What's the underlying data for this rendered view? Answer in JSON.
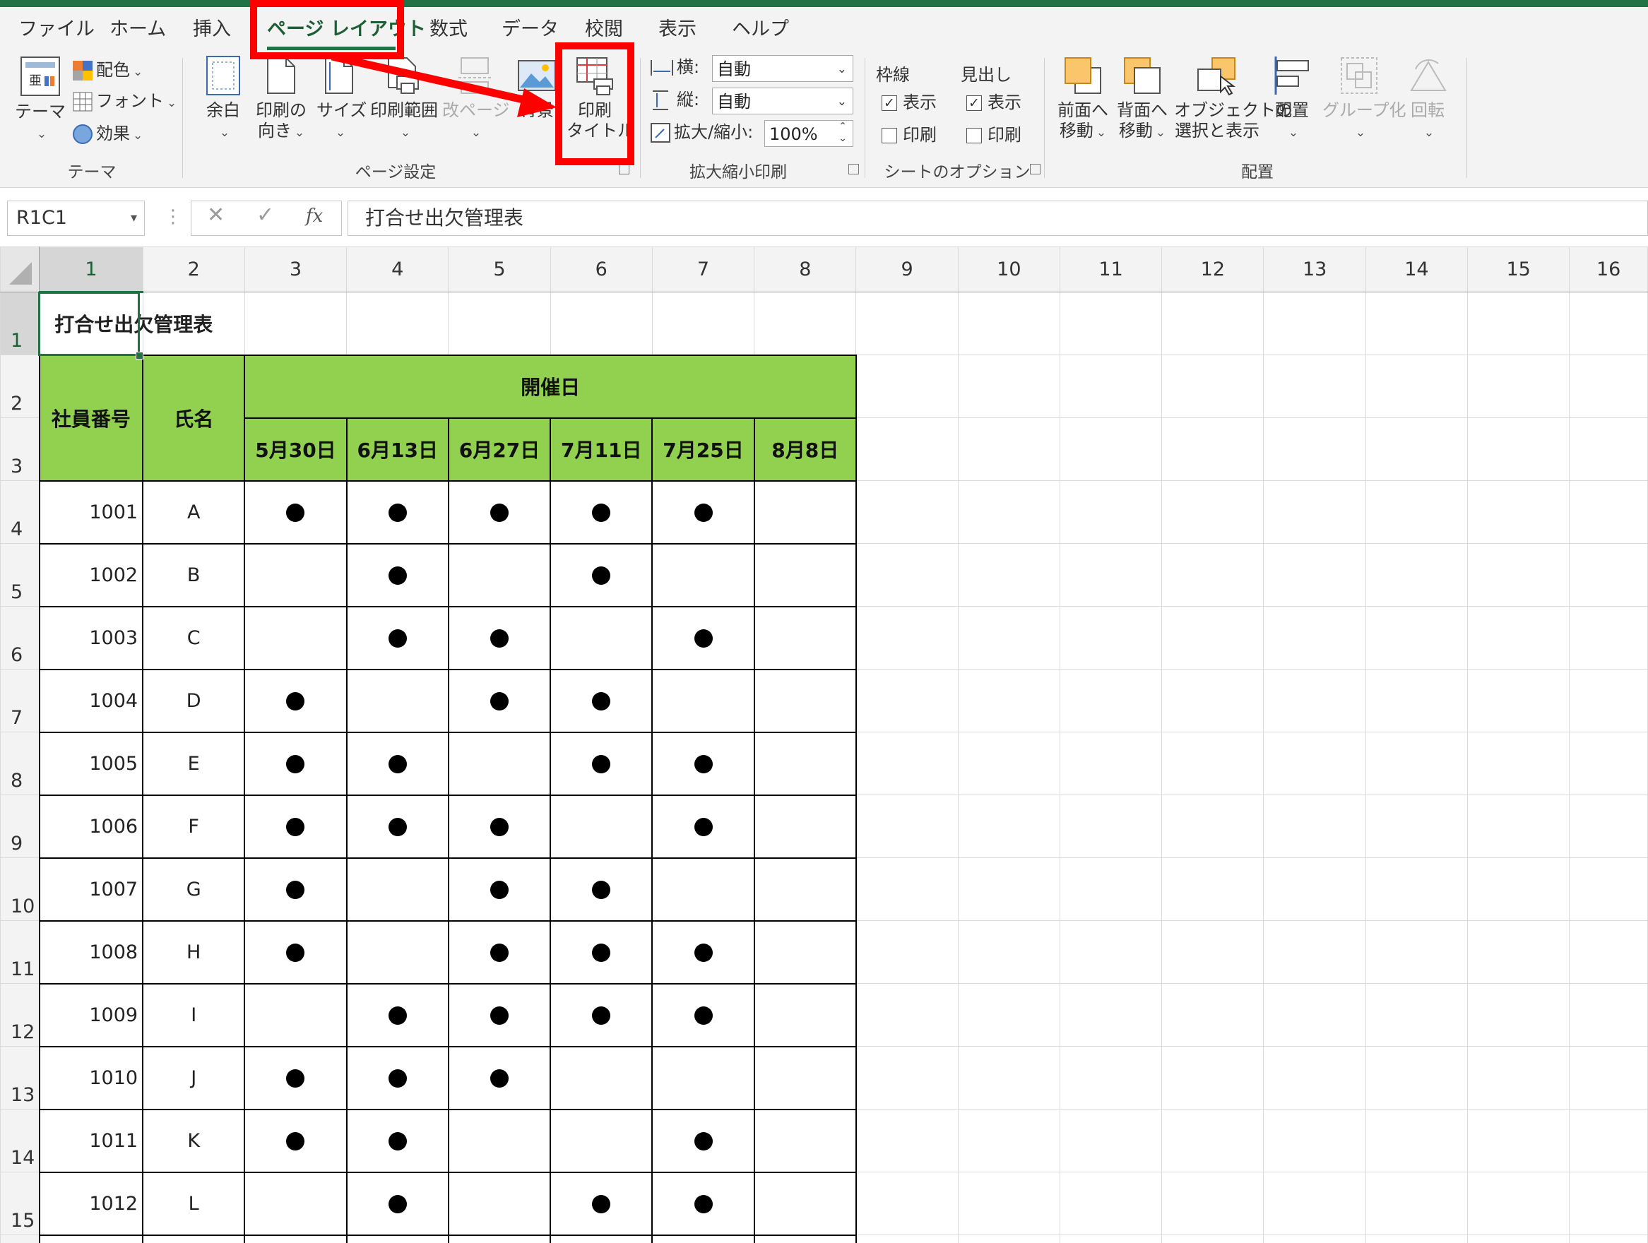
{
  "ribbon_tabs": [
    "ファイル",
    "ホーム",
    "挿入",
    "ページ レイアウト",
    "数式",
    "データ",
    "校閲",
    "表示",
    "ヘルプ"
  ],
  "active_tab": "ページ レイアウト",
  "groups": {
    "theme": {
      "label": "テーマ",
      "theme_button": "テーマ",
      "colors": "配色",
      "fonts": "フォント",
      "effects": "効果"
    },
    "page_setup": {
      "label": "ページ設定",
      "margins": "余白",
      "orientation_l1": "印刷の",
      "orientation_l2": "向き",
      "size": "サイズ",
      "print_area": "印刷範囲",
      "breaks": "改ページ",
      "background": "背景",
      "print_titles_l1": "印刷",
      "print_titles_l2": "タイトル"
    },
    "scale": {
      "label": "拡大縮小印刷",
      "width_label": "横:",
      "width_value": "自動",
      "height_label": "縦:",
      "height_value": "自動",
      "scale_label": "拡大/縮小:",
      "scale_value": "100%"
    },
    "sheet_options": {
      "label": "シートのオプション",
      "gridlines": "枠線",
      "headings": "見出し",
      "view": "表示",
      "print": "印刷",
      "gridlines_view_checked": true,
      "gridlines_print_checked": false,
      "headings_view_checked": true,
      "headings_print_checked": false
    },
    "arrange": {
      "label": "配置",
      "bring_forward_l1": "前面へ",
      "bring_forward_l2": "移動",
      "send_backward_l1": "背面へ",
      "send_backward_l2": "移動",
      "selection_pane_l1": "オブジェクトの",
      "selection_pane_l2": "選択と表示",
      "align": "配置",
      "group": "グループ化",
      "rotate": "回転"
    }
  },
  "formula_bar": {
    "name_box": "R1C1",
    "cancel_glyph": "✕",
    "enter_glyph": "✓",
    "fx_glyph": "fx",
    "content": "打合せ出欠管理表"
  },
  "sheet": {
    "column_headers": [
      "1",
      "2",
      "3",
      "4",
      "5",
      "6",
      "7",
      "8",
      "9",
      "10",
      "11",
      "12",
      "13",
      "14",
      "15",
      "16"
    ],
    "row_headers": [
      "1",
      "2",
      "3",
      "4",
      "5",
      "6",
      "7",
      "8",
      "9",
      "10",
      "11",
      "12",
      "13",
      "14",
      "15"
    ],
    "title": "打合せ出欠管理表",
    "hdr_employee_no": "社員番号",
    "hdr_name": "氏名",
    "hdr_dates": "開催日",
    "dates": [
      "5月30日",
      "6月13日",
      "6月27日",
      "7月11日",
      "7月25日",
      "8月8日"
    ],
    "rows": [
      {
        "no": "1001",
        "name": "A",
        "attend": [
          true,
          true,
          true,
          true,
          true,
          false
        ]
      },
      {
        "no": "1002",
        "name": "B",
        "attend": [
          false,
          true,
          false,
          true,
          false,
          false
        ]
      },
      {
        "no": "1003",
        "name": "C",
        "attend": [
          false,
          true,
          true,
          false,
          true,
          false
        ]
      },
      {
        "no": "1004",
        "name": "D",
        "attend": [
          true,
          false,
          true,
          true,
          false,
          false
        ]
      },
      {
        "no": "1005",
        "name": "E",
        "attend": [
          true,
          true,
          false,
          true,
          true,
          false
        ]
      },
      {
        "no": "1006",
        "name": "F",
        "attend": [
          true,
          true,
          true,
          false,
          true,
          false
        ]
      },
      {
        "no": "1007",
        "name": "G",
        "attend": [
          true,
          false,
          true,
          true,
          false,
          false
        ]
      },
      {
        "no": "1008",
        "name": "H",
        "attend": [
          true,
          false,
          true,
          true,
          true,
          false
        ]
      },
      {
        "no": "1009",
        "name": "I",
        "attend": [
          false,
          true,
          true,
          true,
          true,
          false
        ]
      },
      {
        "no": "1010",
        "name": "J",
        "attend": [
          true,
          true,
          true,
          false,
          false,
          false
        ]
      },
      {
        "no": "1011",
        "name": "K",
        "attend": [
          true,
          true,
          false,
          false,
          true,
          false
        ]
      },
      {
        "no": "1012",
        "name": "L",
        "attend": [
          false,
          true,
          false,
          true,
          true,
          false
        ]
      }
    ]
  },
  "colors": {
    "excel_green": "#217346",
    "header_fill": "#92d050",
    "annotation_red": "#ff0000"
  }
}
